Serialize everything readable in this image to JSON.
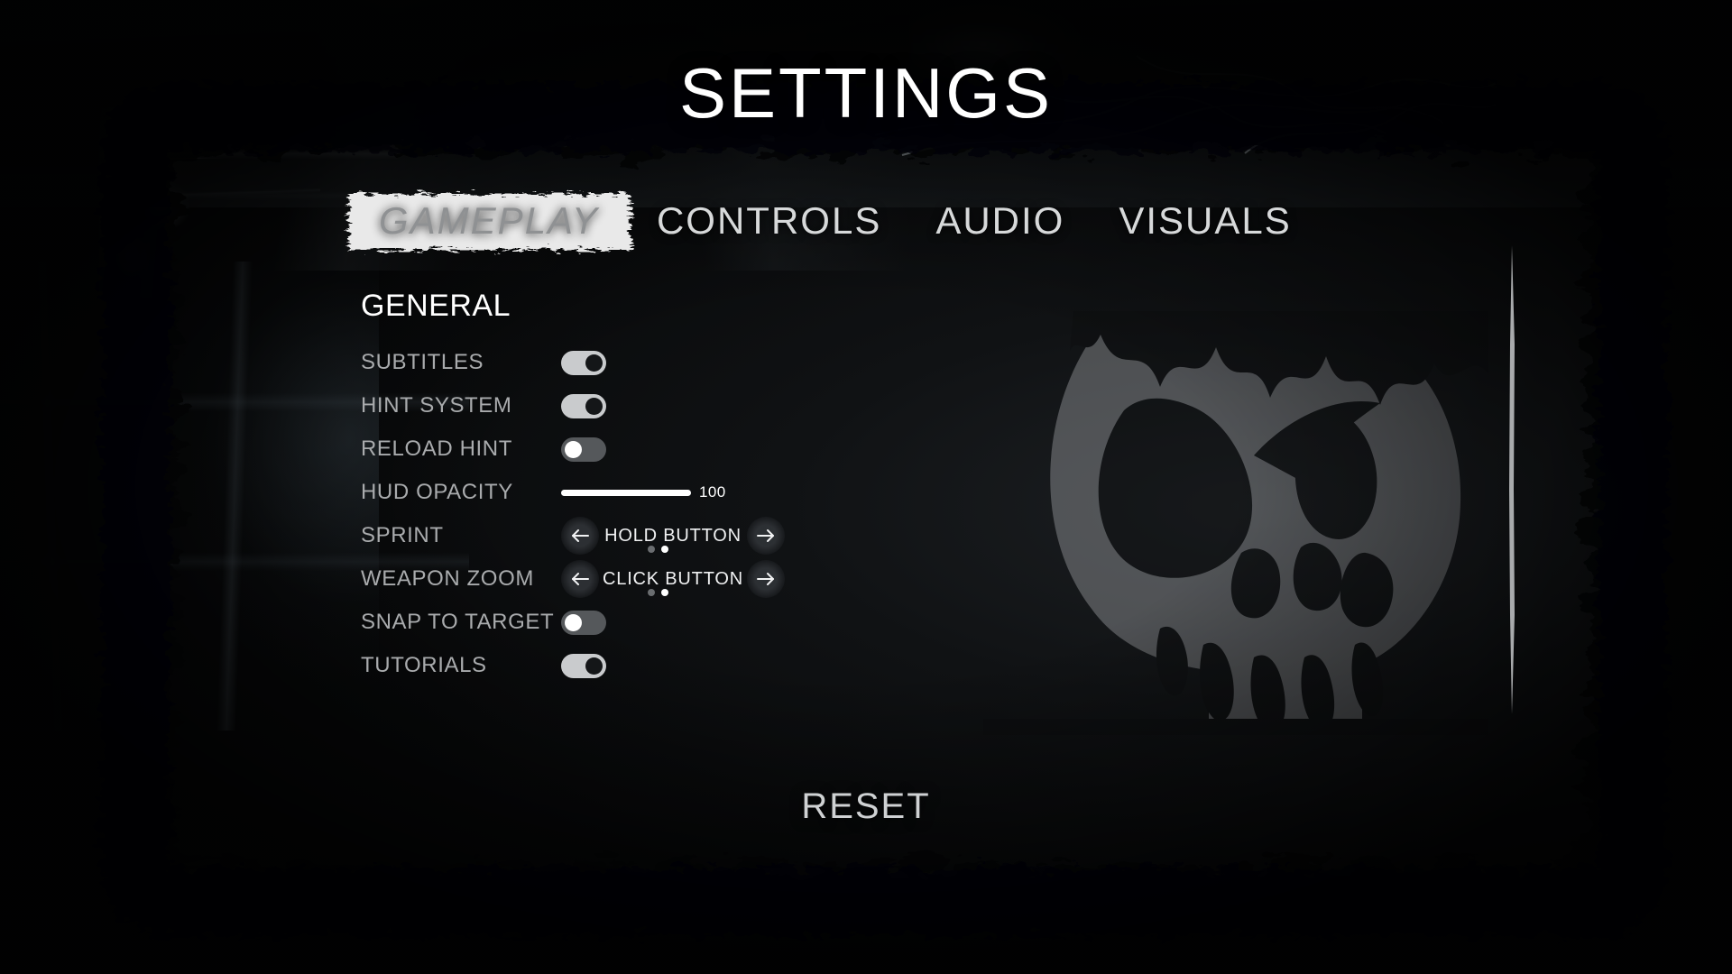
{
  "header": {
    "title": "SETTINGS"
  },
  "tabs": [
    {
      "id": "gameplay",
      "label": "GAMEPLAY",
      "active": true
    },
    {
      "id": "controls",
      "label": "CONTROLS",
      "active": false
    },
    {
      "id": "audio",
      "label": "AUDIO",
      "active": false
    },
    {
      "id": "visuals",
      "label": "VISUALS",
      "active": false
    }
  ],
  "section": {
    "title": "GENERAL"
  },
  "settings": [
    {
      "id": "subtitles",
      "label": "SUBTITLES",
      "type": "toggle",
      "value": "on"
    },
    {
      "id": "hint-system",
      "label": "HINT SYSTEM",
      "type": "toggle",
      "value": "on"
    },
    {
      "id": "reload-hint",
      "label": "RELOAD HINT",
      "type": "toggle",
      "value": "off"
    },
    {
      "id": "hud-opacity",
      "label": "HUD OPACITY",
      "type": "slider",
      "value": "100",
      "percent": 100
    },
    {
      "id": "sprint",
      "label": "SPRINT",
      "type": "selector",
      "value": "HOLD BUTTON",
      "option_count": 2,
      "option_index": 1
    },
    {
      "id": "weapon-zoom",
      "label": "WEAPON ZOOM",
      "type": "selector",
      "value": "CLICK BUTTON",
      "option_count": 2,
      "option_index": 1
    },
    {
      "id": "snap-to-target",
      "label": "SNAP TO TARGET",
      "type": "toggle",
      "value": "off"
    },
    {
      "id": "tutorials",
      "label": "TUTORIALS",
      "type": "toggle",
      "value": "on"
    }
  ],
  "footer": {
    "reset_label": "RESET"
  },
  "icons": {
    "arrow_left": "arrow-left-icon",
    "arrow_right": "arrow-right-icon",
    "scrollbar": "scrollbar-blade"
  },
  "colors": {
    "text_primary": "#ffffff",
    "text_muted": "#a9abad",
    "toggle_on_track": "#c9cbcd",
    "toggle_on_knob": "#141618",
    "toggle_off_track": "#55585b",
    "toggle_off_knob": "#ffffff",
    "slider_fill": "#ffffff",
    "active_tab_brush": "#e8e8e8",
    "active_tab_text": "#8f9193",
    "background": "#07080a"
  }
}
